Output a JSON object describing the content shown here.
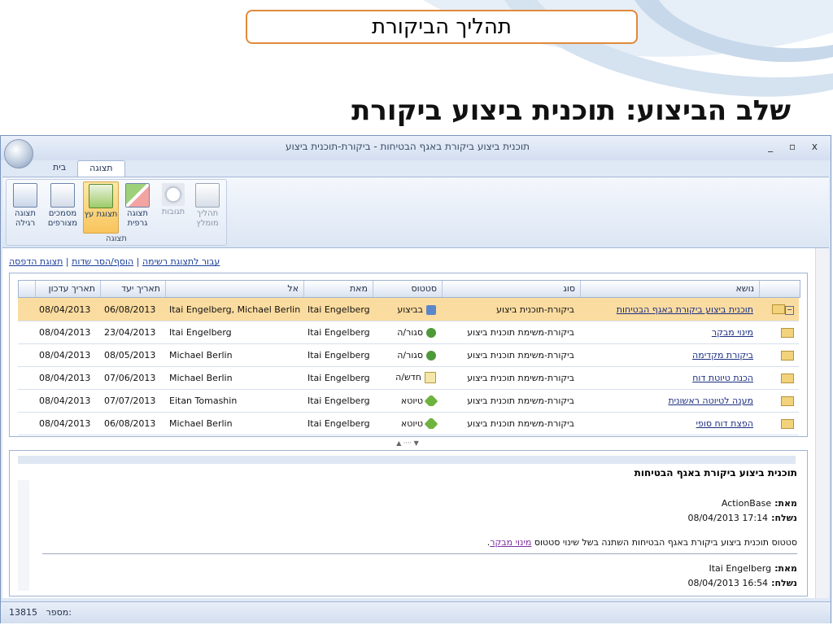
{
  "slide": {
    "title": "תהליך הביקורת",
    "heading": "שלב הביצוע: תוכנית ביצוע ביקורת"
  },
  "window": {
    "title": "תוכנית ביצוע ביקורת באגף הבטיחות - ביקורת-תוכנית ביצוע",
    "controls": "_ ▫ x"
  },
  "ribbon": {
    "tabs": [
      {
        "label": "בית",
        "active": false
      },
      {
        "label": "תצוגה",
        "active": true
      }
    ],
    "group_label": "תצוגה",
    "buttons": [
      {
        "label": "תצוגה רגילה",
        "icon": "list-view-icon"
      },
      {
        "label": "מסמכים מצורפים",
        "icon": "documents-icon"
      },
      {
        "label": "תצוגת עץ",
        "icon": "tree-view-icon",
        "selected": true
      },
      {
        "label": "תצוגה גרפית",
        "icon": "graph-view-icon"
      },
      {
        "label": "תגובות",
        "icon": "responses-icon",
        "disabled": true
      },
      {
        "label": "תהליך מומלץ",
        "icon": "process-icon",
        "disabled": true
      }
    ]
  },
  "links": {
    "list_view": "עבור לתצוגת רשימה",
    "fields": "הוסף/הסר שדות",
    "print": "תצוגת הדפסה"
  },
  "grid": {
    "headers": {
      "subject": "נושא",
      "type": "סוג",
      "status": "סטטוס",
      "from": "מאת",
      "to": "אל",
      "due": "תאריך יעד",
      "updated": "תאריך עדכון"
    },
    "rows": [
      {
        "subject": "תוכנית ביצוע ביקורת באגף הבטיחות",
        "type": "ביקורת-תוכנית ביצוע",
        "status": "בביצוע",
        "status_icon": "thumbs-up-icon",
        "from": "Itai Engelberg",
        "to": "Itai Engelberg, Michael Berlin",
        "due": "06/08/2013",
        "updated": "08/04/2013",
        "highlight": true
      },
      {
        "subject": "מינוי מבקר",
        "type": "ביקורת-משימת תוכנית ביצוע",
        "status": "סגור/ה",
        "status_icon": "closed-icon",
        "from": "Itai Engelberg",
        "to": "Itai Engelberg",
        "due": "23/04/2013",
        "updated": "08/04/2013",
        "highlight": false
      },
      {
        "subject": "ביקורת מקדימה",
        "type": "ביקורת-משימת תוכנית ביצוע",
        "status": "סגור/ה",
        "status_icon": "closed-icon",
        "from": "Itai Engelberg",
        "to": "Michael Berlin",
        "due": "08/05/2013",
        "updated": "08/04/2013",
        "highlight": false
      },
      {
        "subject": "הכנת טיוטת דוח",
        "type": "ביקורת-משימת תוכנית ביצוע",
        "status": "חדש/ה",
        "status_icon": "new-doc-icon",
        "from": "Itai Engelberg",
        "to": "Michael Berlin",
        "due": "07/06/2013",
        "updated": "08/04/2013",
        "highlight": false
      },
      {
        "subject": "מענה לטיוטה ראשונית",
        "type": "ביקורת-משימת תוכנית ביצוע",
        "status": "טיוטא",
        "status_icon": "draft-pencil-icon",
        "from": "Itai Engelberg",
        "to": "Eitan Tomashin",
        "due": "07/07/2013",
        "updated": "08/04/2013",
        "highlight": false
      },
      {
        "subject": "הפצת דוח סופי",
        "type": "ביקורת-משימת תוכנית ביצוע",
        "status": "טיוטא",
        "status_icon": "draft-pencil-icon",
        "from": "Itai Engelberg",
        "to": "Michael Berlin",
        "due": "06/08/2013",
        "updated": "08/04/2013",
        "highlight": false
      }
    ]
  },
  "preview": {
    "title": "תוכנית ביצוע ביקורת באגף הבטיחות",
    "from_label": "מאת:",
    "sent_label": "נשלח:",
    "entry1_from": "ActionBase",
    "entry1_sent": "17:14 08/04/2013",
    "message_prefix": "סטטוס תוכנית ביצוע ביקורת באגף הבטיחות השתנה בשל שינוי סטטוס",
    "message_link": "מינוי מבקר",
    "message_suffix": ".",
    "entry2_from": "Itai Engelberg",
    "entry2_sent": "16:54 08/04/2013"
  },
  "status_bar": {
    "label": "מספר:",
    "number": "13815"
  }
}
